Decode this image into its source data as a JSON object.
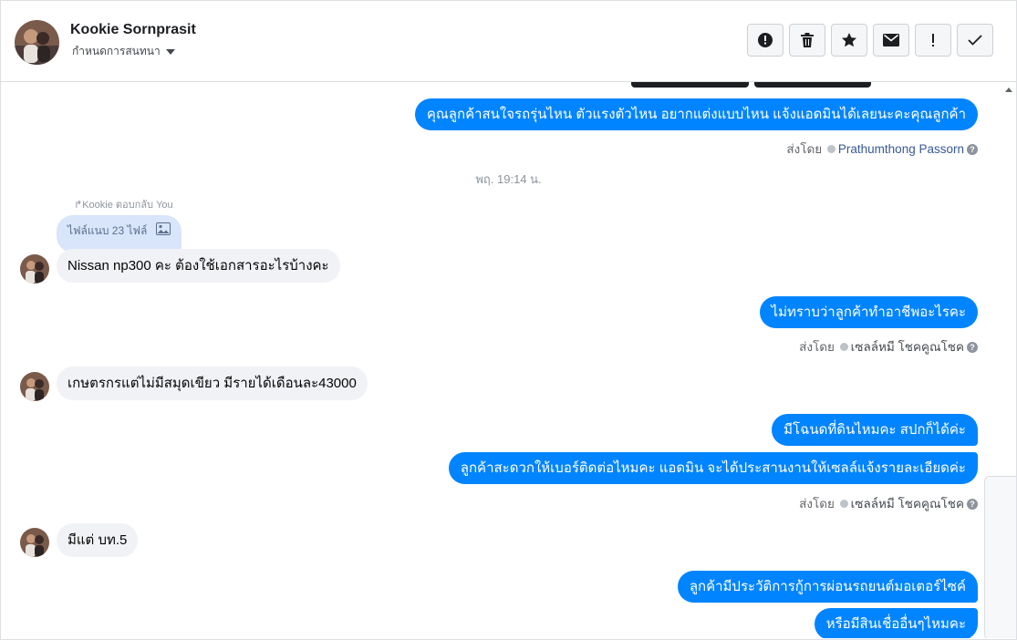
{
  "header": {
    "name": "Kookie Sornprasit",
    "subtitle": "กำหนดการสนทนา",
    "actions": [
      "alert-icon",
      "trash-icon",
      "star-icon",
      "envelope-icon",
      "exclamation-icon",
      "check-icon"
    ]
  },
  "messages": {
    "m1": "คุณลูกค้าสนใจรถรุ่นไหน ตัวแรงตัวไหน อยากแต่งแบบไหน แจ้งแอดมินได้เลยนะคะคุณลูกค้า",
    "m1_sent_prefix": "ส่งโดย",
    "m1_sender": "Prathumthong Passorn",
    "timestamp": "พฤ. 19:14 น.",
    "reply_label": "Kookie ตอบกลับ You",
    "reply_attachment": "ไฟล์แนบ 23 ไฟล์",
    "m2": "Nissan np300 คะ  ต้องใช้เอกสารอะไรบ้างคะ",
    "m3": "ไม่ทราบว่าลูกค้าทำอาชีพอะไรคะ",
    "m3_sent_prefix": "ส่งโดย",
    "m3_sender": "เซลล์หมี โชคคูณโชค",
    "m4": "เกษตรกรแต่ไม่มีสมุดเขียว มีรายได้เดือนละ43000",
    "m5": "มีโฉนดที่ดินไหมคะ สปกก็ได้ค่ะ",
    "m6": "ลูกค้าสะดวกให้เบอร์ติดต่อไหมคะ แอดมิน จะได้ประสานงานให้เซลล์แจ้งรายละเอียดค่ะ",
    "m6_sent_prefix": "ส่งโดย",
    "m6_sender": "เซลล์หมี โชคคูณโชค",
    "m7": "มีแต่ บท.5",
    "m8": "ลูกค้ามีประวัติการกู้การผ่อนรถยนต์มอเตอร์ไซค์",
    "m9": "หรือมีสินเชื่ออื่นๆไหมคะ"
  },
  "colors": {
    "outgoing": "#0084ff",
    "incoming": "#f0f2f5",
    "reply": "#d8e5fb"
  }
}
